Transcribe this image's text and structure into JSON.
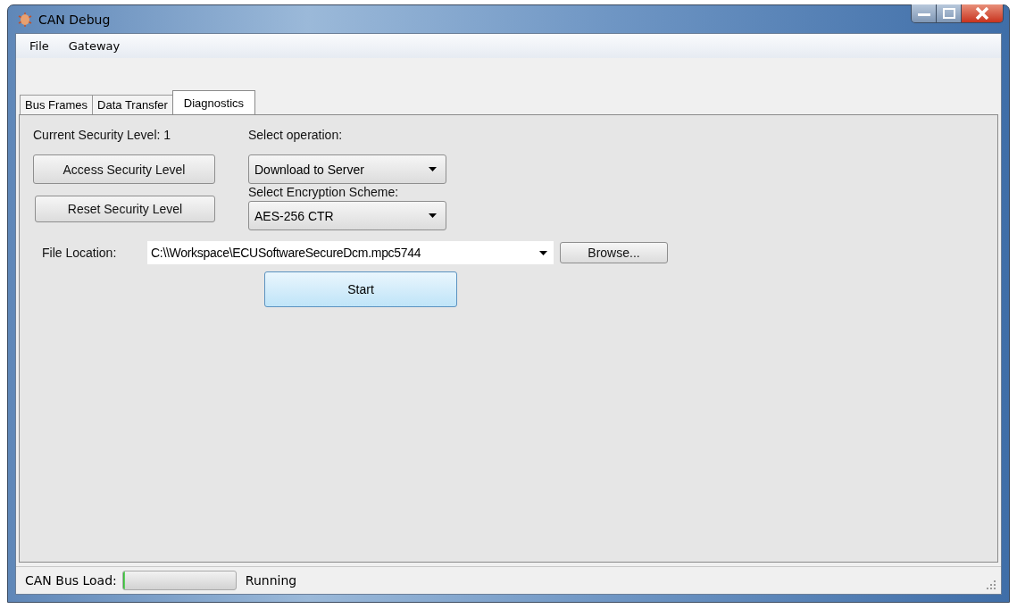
{
  "window": {
    "title": "CAN Debug"
  },
  "menu": [
    {
      "label": "File"
    },
    {
      "label": "Gateway"
    }
  ],
  "tabs": [
    {
      "label": "Bus Frames",
      "selected": false
    },
    {
      "label": "Data Transfer",
      "selected": false
    },
    {
      "label": "Diagnostics",
      "selected": true
    }
  ],
  "diagnostics": {
    "security_level_label": "Current Security Level: 1",
    "access_button": "Access Security Level",
    "reset_button": "Reset Security Level",
    "operation_label": "Select operation:",
    "operation_value": "Download to Server",
    "encryption_label": "Select Encryption Scheme:",
    "encryption_value": "AES-256 CTR",
    "file_location_label": "File Location:",
    "file_location_value": "C:\\\\Workspace\\ECUSoftwareSecureDcm.mpc5744",
    "browse_button": "Browse...",
    "start_button": "Start"
  },
  "status_bar": {
    "bus_load_label": "CAN Bus Load:",
    "bus_load": {
      "level": 0.02
    },
    "state": "Running"
  }
}
